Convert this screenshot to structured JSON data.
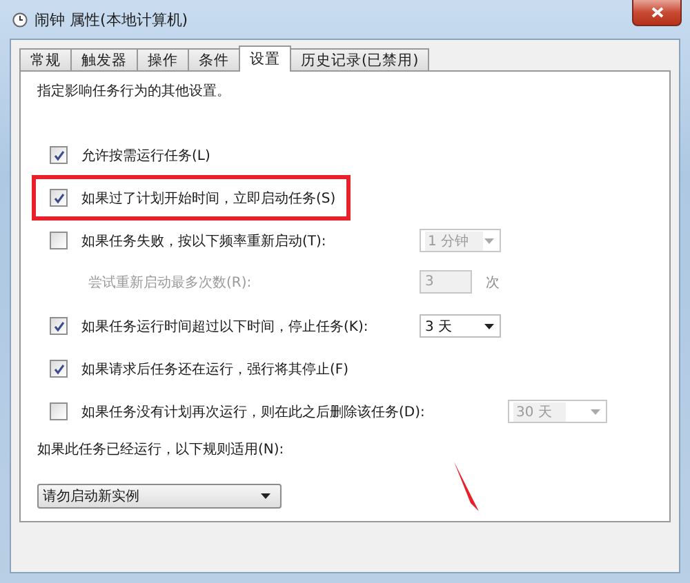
{
  "window": {
    "title": "闹钟 属性(本地计算机)"
  },
  "tabs": [
    {
      "label": "常规",
      "selected": false
    },
    {
      "label": "触发器",
      "selected": false
    },
    {
      "label": "操作",
      "selected": false
    },
    {
      "label": "条件",
      "selected": false
    },
    {
      "label": "设置",
      "selected": true
    },
    {
      "label": "历史记录(已禁用)",
      "selected": false
    }
  ],
  "description": "指定影响任务行为的其他设置。",
  "options": [
    {
      "kind": "checkbox",
      "label": "允许按需运行任务(L)",
      "checked": true,
      "disabled": false
    },
    {
      "kind": "checkbox",
      "label": "如果过了计划开始时间，立即启动任务(S)",
      "checked": true,
      "disabled": false,
      "highlighted": true
    },
    {
      "kind": "checkbox",
      "label": "如果任务失败，按以下频率重新启动(T):",
      "checked": false,
      "disabled": false,
      "control": {
        "kind": "select",
        "value": "1 分钟",
        "disabled": true
      }
    },
    {
      "kind": "text",
      "label": "尝试重新启动最多次数(R):",
      "disabled": true,
      "control": {
        "kind": "spin",
        "value": "3",
        "unit": "次",
        "disabled": true
      }
    },
    {
      "kind": "checkbox",
      "label": "如果任务运行时间超过以下时间，停止任务(K):",
      "checked": true,
      "disabled": false,
      "control": {
        "kind": "select",
        "value": "3 天",
        "disabled": false
      }
    },
    {
      "kind": "checkbox",
      "label": "如果请求后任务还在运行，强行将其停止(F)",
      "checked": true,
      "disabled": false
    },
    {
      "kind": "checkbox",
      "label": "如果任务没有计划再次运行，则在此之后删除该任务(D):",
      "checked": false,
      "disabled": false,
      "control": {
        "kind": "select",
        "value": "30 天",
        "disabled": true,
        "wide": true
      }
    }
  ],
  "rule_label": "如果此任务已经运行，以下规则适用(N):",
  "rule_select": {
    "value": "请勿启动新实例"
  }
}
